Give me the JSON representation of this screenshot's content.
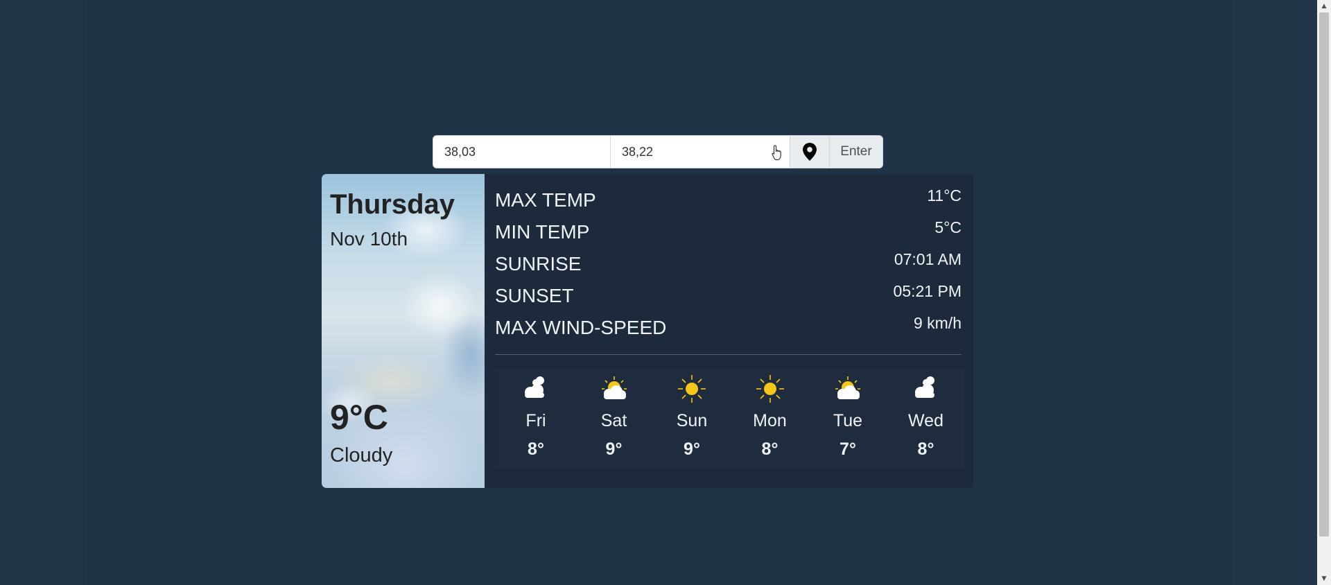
{
  "search": {
    "latitude_value": "38,03",
    "longitude_value": "38,22",
    "location_icon": "map-pin-icon",
    "enter_label": "Enter"
  },
  "today": {
    "day": "Thursday",
    "date": "Nov 10th",
    "temperature": "9°C",
    "condition": "Cloudy"
  },
  "stats": [
    {
      "label": "MAX TEMP",
      "value": "11°C"
    },
    {
      "label": "MIN TEMP",
      "value": "5°C"
    },
    {
      "label": "SUNRISE",
      "value": "07:01 AM"
    },
    {
      "label": "SUNSET",
      "value": "05:21 PM"
    },
    {
      "label": "MAX WIND-SPEED",
      "value": "9 km/h"
    }
  ],
  "forecast": [
    {
      "day": "Fri",
      "temp": "8°",
      "icon": "clouds-icon"
    },
    {
      "day": "Sat",
      "temp": "9°",
      "icon": "partly-cloudy-icon"
    },
    {
      "day": "Sun",
      "temp": "9°",
      "icon": "sun-icon"
    },
    {
      "day": "Mon",
      "temp": "8°",
      "icon": "sun-icon"
    },
    {
      "day": "Tue",
      "temp": "7°",
      "icon": "partly-cloudy-icon"
    },
    {
      "day": "Wed",
      "temp": "8°",
      "icon": "clouds-icon"
    }
  ],
  "colors": {
    "background": "#223448",
    "card": "#1c2a3b",
    "sun": "#f5c518",
    "text": "#f1f4f7"
  }
}
